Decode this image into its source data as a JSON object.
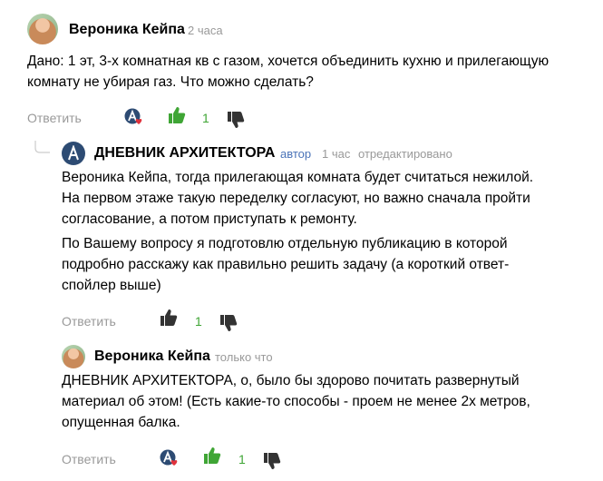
{
  "comment1": {
    "author": "Вероника Кейпа",
    "time": "2 часа",
    "lines": [
      "Дано: 1 эт, 3-х комнатная кв с газом, хочется объединить кухню и прилегающую",
      "комнату не убирая газ. Что можно сделать?"
    ],
    "reply_label": "Ответить",
    "likes": "1",
    "like_color": "#3fa535"
  },
  "comment2": {
    "author": "ДНЕВНИК АРХИТЕКТОРА",
    "badge": "автор",
    "time": "1 час",
    "edited": "отредактировано",
    "p1_lines": [
      "Вероника Кейпа, тогда прилегающая комната будет считаться нежилой.",
      "На первом этаже такую переделку согласуют, но важно сначала пройти",
      "согласование, а потом приступать к ремонту."
    ],
    "p2_lines": [
      "По Вашему вопросу я подготовлю отдельную публикацию в которой",
      "подробно расскажу как правильно решить задачу (а короткий ответ-",
      "спойлер выше)"
    ],
    "reply_label": "Ответить",
    "likes": "1"
  },
  "comment3": {
    "author": "Вероника Кейпа",
    "time": "только что",
    "lines": [
      "ДНЕВНИК АРХИТЕКТОРА, о, было бы здорово почитать развернутый",
      "материал об этом! (Есть какие-то способы - проем не менее 2х метров,",
      "опущенная балка."
    ],
    "reply_label": "Ответить",
    "likes": "1"
  },
  "colors": {
    "accent_green": "#3fa535",
    "logo_blue": "#2d4b73",
    "heart_red": "#e0323c",
    "muted": "#999999"
  }
}
